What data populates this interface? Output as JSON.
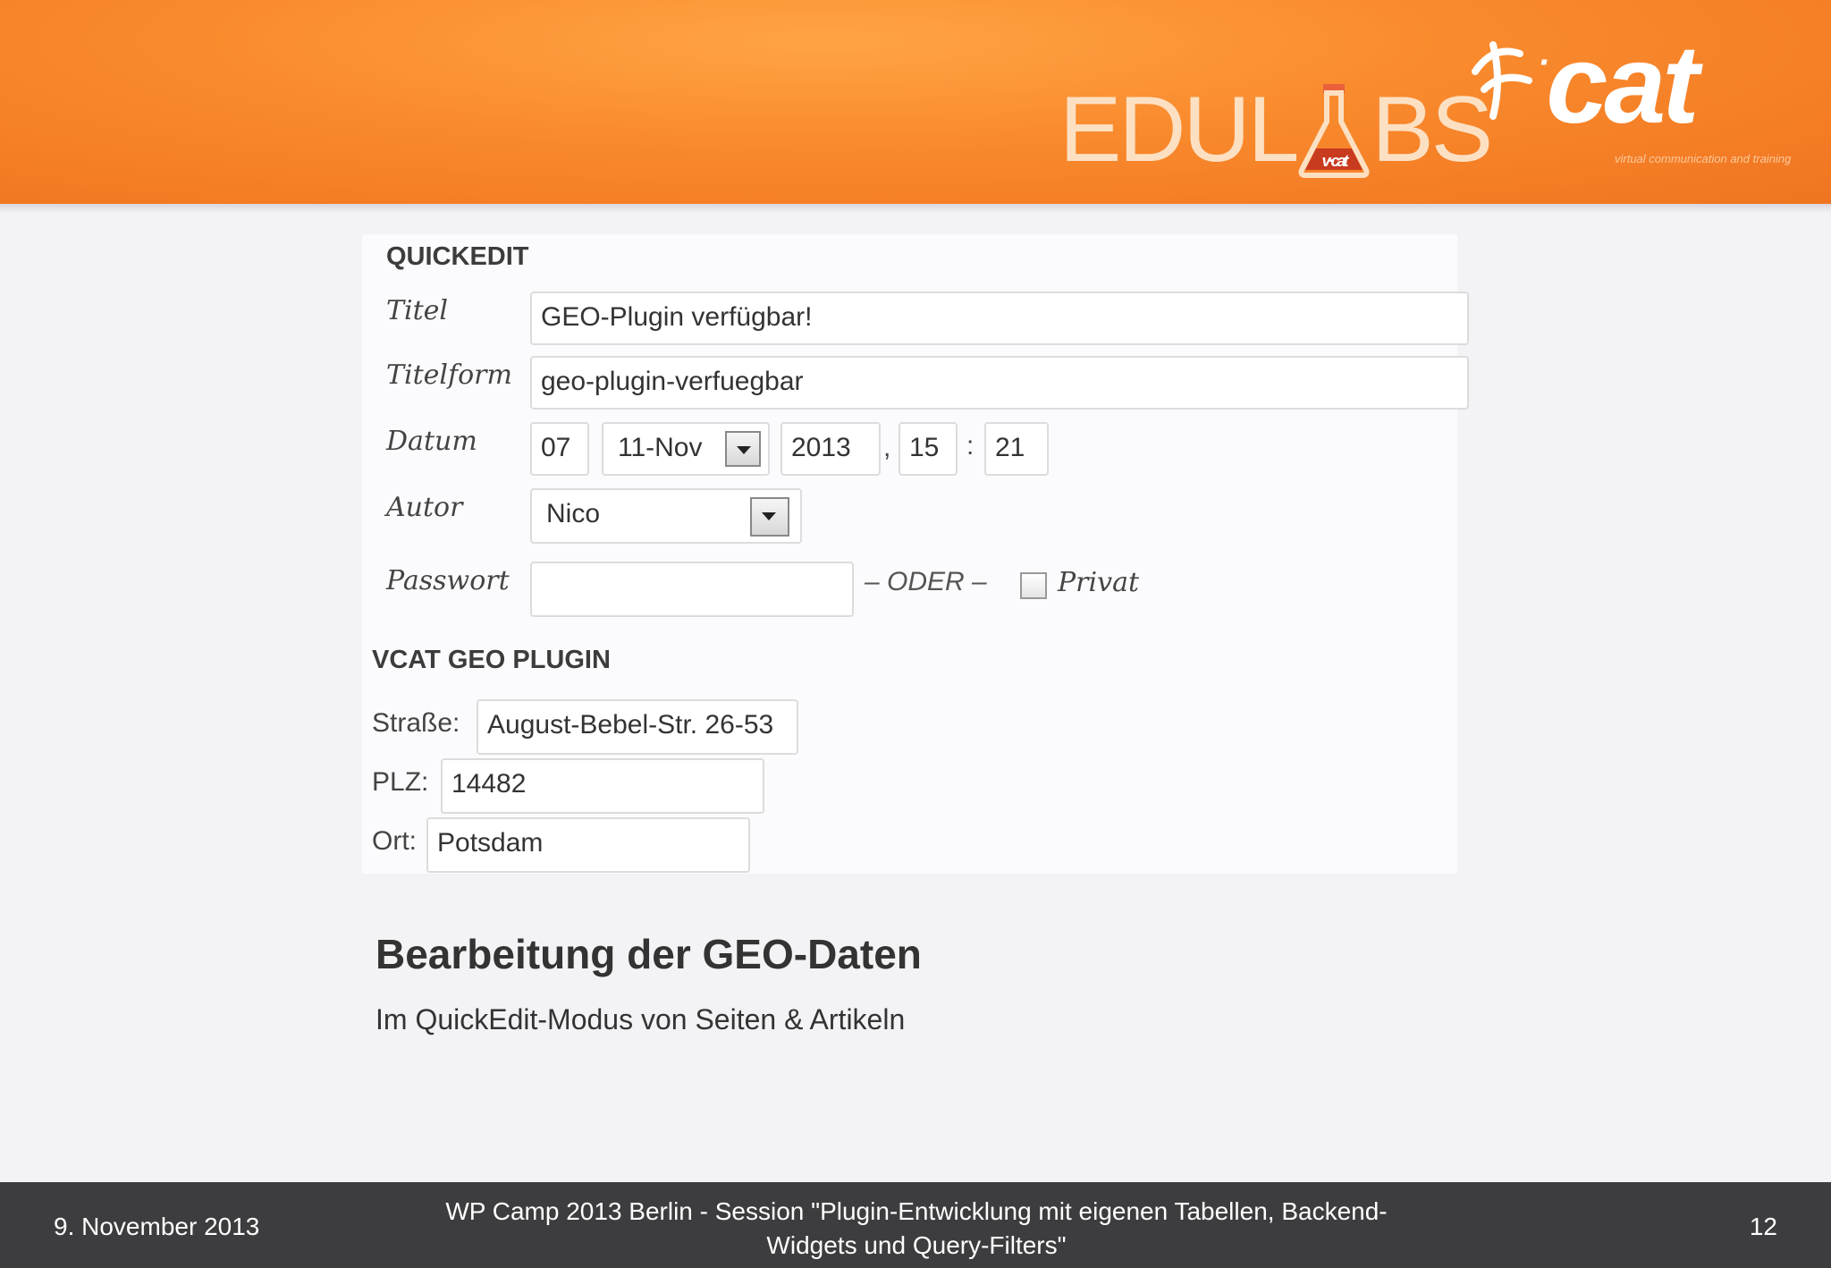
{
  "brand": {
    "edulabs_logo": "EDULABS",
    "edulabs_flask_text": "v·cat",
    "vcat_logo": "v·cat",
    "vcat_tagline": "virtual communication and training"
  },
  "quickedit": {
    "section_title": "QUICKEDIT",
    "title_label": "Titel",
    "title_value": "GEO-Plugin verfügbar!",
    "slug_label": "Titelform",
    "slug_value": "geo-plugin-verfuegbar",
    "date_label": "Datum",
    "day_value": "07",
    "month_value": "11-Nov",
    "year_value": "2013",
    "comma": ",",
    "hour_value": "15",
    "colon": ":",
    "minute_value": "21",
    "author_label": "Autor",
    "author_value": "Nico",
    "password_label": "Passwort",
    "password_value": "",
    "oder_text": "– ODER –",
    "private_label": "Privat"
  },
  "geo_plugin": {
    "section_title": "VCAT GEO PLUGIN",
    "street_label": "Straße:",
    "street_value": "August-Bebel-Str. 26-53",
    "zip_label": "PLZ:",
    "zip_value": "14482",
    "city_label": "Ort:",
    "city_value": "Potsdam"
  },
  "slide": {
    "title": "Bearbeitung der GEO-Daten",
    "subtitle": "Im QuickEdit-Modus von Seiten & Artikeln"
  },
  "footer": {
    "date": "9. November 2013",
    "center_line1": "WP Camp 2013 Berlin - Session \"Plugin-Entwicklung mit eigenen Tabellen, Backend-",
    "center_line2": "Widgets und Query-Filters\"",
    "page_number": "12"
  },
  "colors": {
    "header_orange": "#f98a2d",
    "footer_bg": "#3d3d3f"
  }
}
